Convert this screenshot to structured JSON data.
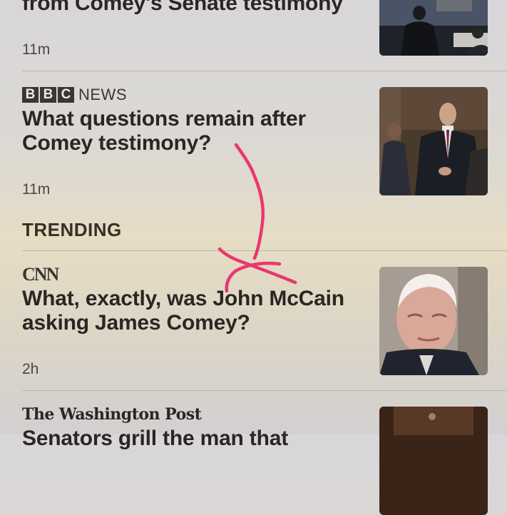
{
  "articles": [
    {
      "headline": "from Comey's Senate testimony",
      "time": "11m"
    },
    {
      "source": {
        "box_letters": [
          "B",
          "B",
          "C"
        ],
        "name": "NEWS"
      },
      "headline": "What questions remain after Comey testimony?",
      "time": "11m"
    }
  ],
  "trending": {
    "title": "TRENDING",
    "articles": [
      {
        "source": {
          "name": "CNN"
        },
        "headline": "What, exactly, was John McCain asking James Comey?",
        "time": "2h"
      },
      {
        "source": {
          "name": "The Washington Post"
        },
        "headline": "Senators grill the man that"
      }
    ]
  },
  "colors": {
    "annotation": "#e8386f",
    "headline": "#2a2622",
    "section_title": "#3a2f22"
  }
}
